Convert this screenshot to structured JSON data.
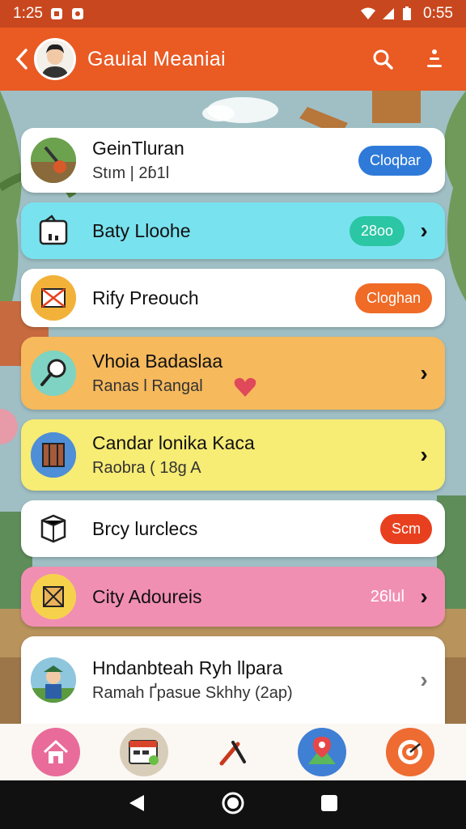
{
  "status_bar": {
    "time_left": "1:25",
    "time_right": "0:55"
  },
  "app_bar": {
    "title": "Gauial Meaniai"
  },
  "items": [
    {
      "title": "GeinTluran",
      "subtitle": "Stım | 2ɓ1l",
      "badge": "Cloqbar",
      "badge_color": "#2f7ad9",
      "bg": "#ffffff",
      "chevron": ""
    },
    {
      "title": "Baty Lloohe",
      "subtitle": "",
      "badge": "28oo",
      "badge_color": "#2bc6a3",
      "bg": "#79e2ef",
      "chevron": "›"
    },
    {
      "title": "Rify Preouch",
      "subtitle": "",
      "badge": "Cloghan",
      "badge_color": "#ef6b26",
      "bg": "#ffffff",
      "chevron": ""
    },
    {
      "title": "Vhoia Badaslaa",
      "subtitle": "Ranas l Rangal",
      "badge": "",
      "badge_color": "",
      "bg": "#f6b95c",
      "chevron": "›"
    },
    {
      "title": "Candar lonika Kaca",
      "subtitle": "Raobra ( 18g A",
      "badge": "",
      "badge_color": "",
      "bg": "#f7ec74",
      "chevron": "›"
    },
    {
      "title": "Brcy lurclecs",
      "subtitle": "",
      "badge": "Scm",
      "badge_color": "#e8401e",
      "bg": "#ffffff",
      "chevron": ""
    },
    {
      "title": "City Adoureis",
      "subtitle": "",
      "badge": "26lul",
      "badge_color": "",
      "bg": "#f18fb2",
      "chevron": "›"
    },
    {
      "title": "Hndanbteah Ryh llpara",
      "subtitle": "Ramah Ґpasue Skhhy (2ap)",
      "badge": "",
      "badge_color": "",
      "bg": "#ffffff",
      "chevron": "›"
    }
  ],
  "colors": {
    "primary": "#ea5a23",
    "status_bar": "#c9471e"
  }
}
